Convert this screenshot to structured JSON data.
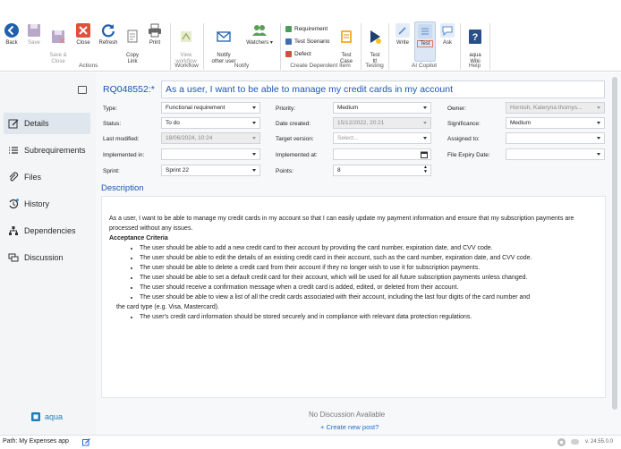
{
  "ribbon": {
    "buttons": {
      "back": "Back",
      "save": "Save",
      "save_close": "Save &\nClose",
      "close": "Close",
      "refresh": "Refresh",
      "copy_link": "Copy\nLink",
      "print": "Print",
      "view_workflow": "View\nworkflow",
      "notify_other_user": "Notify\nother user",
      "watchers": "Watchers",
      "test_case": "Test\nCase",
      "test_it": "Test\nIt!",
      "write": "Write",
      "test": "Test",
      "ask": "Ask",
      "aqua_wiki": "aqua\nWiki"
    },
    "create_items": [
      "Requirement",
      "Test Scenario",
      "Defect"
    ],
    "groups": {
      "actions": "Actions",
      "workflow": "Workflow",
      "notify": "Notify",
      "create_dependent": "Create Dependent Item",
      "testing": "Testing",
      "ai_copilot": "AI Copilot",
      "help": "Help"
    }
  },
  "sidebar": {
    "items": [
      "Details",
      "Subrequirements",
      "Files",
      "History",
      "Dependencies",
      "Discussion"
    ],
    "brand": "aqua"
  },
  "item": {
    "id": "RQ048552:*",
    "title": "As a user, I want to be able to manage my credit cards in my account"
  },
  "fields": {
    "type": {
      "label": "Type:",
      "value": "Functional requirement"
    },
    "priority": {
      "label": "Priority:",
      "value": "Medium"
    },
    "owner": {
      "label": "Owner:",
      "value": "Hornish, Kateryna thornys..."
    },
    "status": {
      "label": "Status:",
      "value": "To do"
    },
    "date_created": {
      "label": "Date created:",
      "value": "15/12/2022, 20:21"
    },
    "significance": {
      "label": "Significance:",
      "value": "Medium"
    },
    "last_modified": {
      "label": "Last modified:",
      "value": "18/06/2024, 10:24"
    },
    "target_version": {
      "label": "Target version:",
      "placeholder": "Select..."
    },
    "assigned_to": {
      "label": "Assigned to:",
      "value": ""
    },
    "implemented_in": {
      "label": "Implemented in:",
      "value": ""
    },
    "implemented_at": {
      "label": "Implemented at:",
      "value": ""
    },
    "file_expiry": {
      "label": "File Expiry Date:",
      "value": ""
    },
    "sprint": {
      "label": "Sprint:",
      "value": "Sprint 22"
    },
    "points": {
      "label": "Points:",
      "value": "8"
    }
  },
  "description": {
    "heading": "Description",
    "intro": "As a user, I want to be able to manage my credit cards in my account so that I can easily update my payment information and ensure that my subscription payments are processed without any issues.",
    "criteria_heading": "Acceptance Criteria",
    "criteria": [
      "The user should be able to add a new credit card to their account by providing the card number, expiration date, and CVV code.",
      "The user should be able to edit the details of an existing credit card in their account, such as the card number, expiration date, and CVV code.",
      "The user should be able to delete a credit card from their account if they no longer wish to use it for subscription payments.",
      "The user should be able to set a default credit card for their account, which will be used for all future subscription payments unless changed.",
      "The user should receive a confirmation message when a credit card is added, edited, or deleted from their account.",
      "The user should be able to view a list of all the credit cards associated with their account, including the last four digits of the card number and",
      "the card type (e.g. Visa, Mastercard).",
      "The user's credit card information should be stored securely and in compliance with relevant data protection regulations."
    ]
  },
  "discussion": {
    "empty": "No Discussion Available",
    "new_post": "+ Create new post?"
  },
  "statusbar": {
    "path": "Path:  My Expenses app",
    "version": "v. 24.55.0.0"
  },
  "colors": {
    "accent": "#1a56b0",
    "active_nav": "#dfe6ee"
  }
}
